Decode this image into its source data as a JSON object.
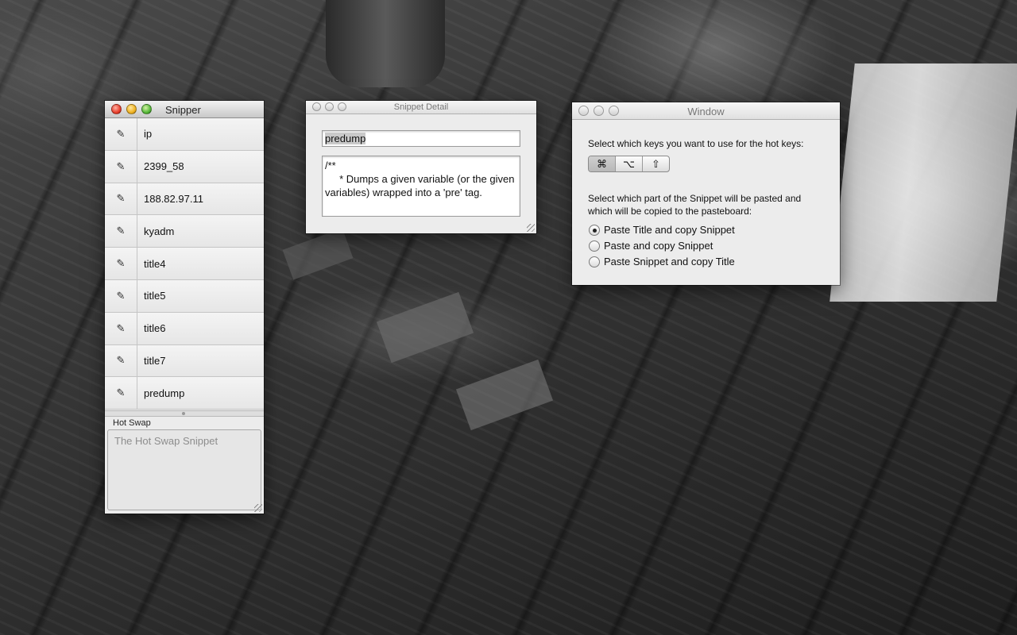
{
  "desktop": {
    "wallpaper": "mixing-console-photo"
  },
  "snipper": {
    "title": "Snipper",
    "edit_icon": "pencil-icon",
    "snippets": [
      {
        "label": "ip"
      },
      {
        "label": "2399_58"
      },
      {
        "label": "188.82.97.11"
      },
      {
        "label": "kyadm"
      },
      {
        "label": "title4"
      },
      {
        "label": "title5"
      },
      {
        "label": "title6"
      },
      {
        "label": "title7"
      },
      {
        "label": "predump"
      }
    ],
    "hot_swap_label": "Hot Swap",
    "hot_swap_placeholder": "The Hot Swap Snippet"
  },
  "detail": {
    "title": "Snippet Detail",
    "snippet_title": "predump",
    "snippet_body": "/**\n     * Dumps a given variable (or the given variables) wrapped into a 'pre' tag."
  },
  "prefs": {
    "title": "Window",
    "hotkeys_prompt": "Select which keys you want to use for the hot keys:",
    "keys": [
      {
        "symbol": "⌘",
        "name": "command-key-icon",
        "selected": true
      },
      {
        "symbol": "⌥",
        "name": "option-key-icon",
        "selected": false
      },
      {
        "symbol": "⇧",
        "name": "shift-key-icon",
        "selected": false
      }
    ],
    "paste_prompt_line1": "Select which part of the Snippet will be pasted and",
    "paste_prompt_line2": "which will be copied to the pasteboard:",
    "options": [
      {
        "label": "Paste Title and copy Snippet",
        "selected": true
      },
      {
        "label": "Paste and copy Snippet",
        "selected": false
      },
      {
        "label": "Paste Snippet and copy Title",
        "selected": false
      }
    ]
  }
}
